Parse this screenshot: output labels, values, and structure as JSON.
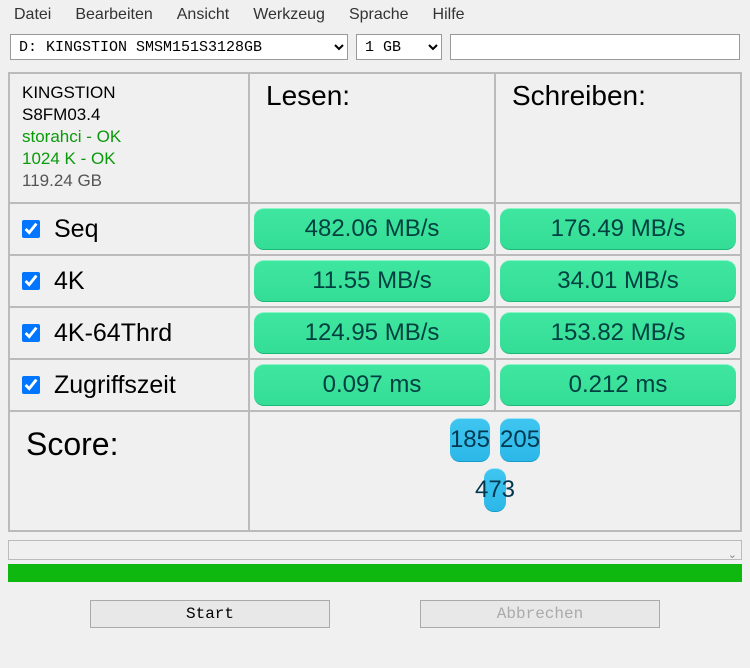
{
  "menu": {
    "file": "Datei",
    "edit": "Bearbeiten",
    "view": "Ansicht",
    "tool": "Werkzeug",
    "language": "Sprache",
    "help": "Hilfe"
  },
  "toolbar": {
    "drive_selected": "D: KINGSTION SMSM151S3128GB",
    "size_selected": "1 GB"
  },
  "info": {
    "name": "KINGSTION",
    "firmware": "S8FM03.4",
    "driver": "storahci - OK",
    "block": "1024 K - OK",
    "capacity": "119.24 GB"
  },
  "headers": {
    "read": "Lesen:",
    "write": "Schreiben:"
  },
  "tests": {
    "seq": {
      "label": "Seq",
      "read": "482.06 MB/s",
      "write": "176.49 MB/s",
      "checked": true
    },
    "k4": {
      "label": "4K",
      "read": "11.55 MB/s",
      "write": "34.01 MB/s",
      "checked": true
    },
    "k4_64": {
      "label": "4K-64Thrd",
      "read": "124.95 MB/s",
      "write": "153.82 MB/s",
      "checked": true
    },
    "acc": {
      "label": "Zugriffszeit",
      "read": "0.097 ms",
      "write": "0.212 ms",
      "checked": true
    }
  },
  "score": {
    "label": "Score:",
    "read": "185",
    "write": "205",
    "total": "473"
  },
  "buttons": {
    "start": "Start",
    "cancel": "Abbrechen"
  },
  "colors": {
    "green_pill": "#34dd95",
    "blue_pill": "#2cb8e8",
    "progress": "#0eb80e",
    "ok_text": "#0a9a0a"
  }
}
